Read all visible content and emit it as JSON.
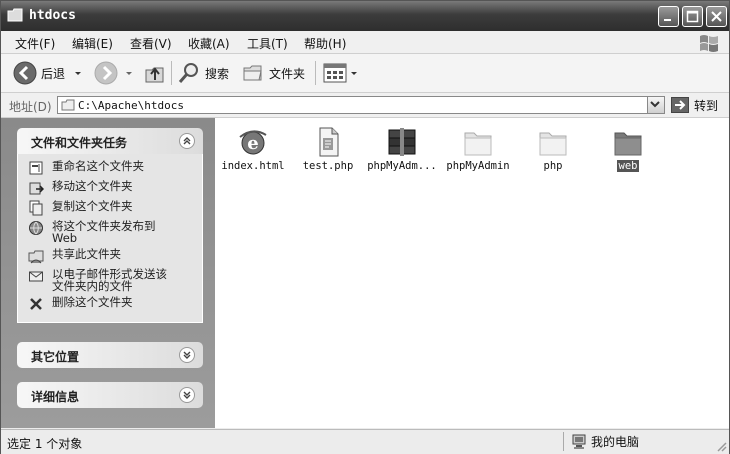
{
  "window": {
    "title": "htdocs"
  },
  "menu": [
    "文件(F)",
    "编辑(E)",
    "查看(V)",
    "收藏(A)",
    "工具(T)",
    "帮助(H)"
  ],
  "toolbar": {
    "back_label": "后退",
    "search_label": "搜索",
    "folders_label": "文件夹"
  },
  "address": {
    "label": "地址(D)",
    "path": "C:\\Apache\\htdocs",
    "go_label": "转到"
  },
  "tasks_panel": {
    "title": "文件和文件夹任务",
    "items": [
      {
        "label": "重命名这个文件夹",
        "icon": "rename-icon"
      },
      {
        "label": "移动这个文件夹",
        "icon": "move-icon"
      },
      {
        "label": "复制这个文件夹",
        "icon": "copy-icon"
      },
      {
        "label": "将这个文件夹发布到",
        "label2": "Web",
        "icon": "publish-web-icon"
      },
      {
        "label": "共享此文件夹",
        "icon": "share-icon"
      },
      {
        "label": "以电子邮件形式发送该",
        "label2": "文件夹内的文件",
        "icon": "email-icon"
      },
      {
        "label": "删除这个文件夹",
        "icon": "delete-icon"
      }
    ]
  },
  "other_places": {
    "title": "其它位置"
  },
  "details": {
    "title": "详细信息"
  },
  "files": [
    {
      "name": "index.html",
      "icon": "ie-html-icon"
    },
    {
      "name": "test.php",
      "icon": "php-file-icon"
    },
    {
      "name": "phpMyAdm...",
      "icon": "archive-icon"
    },
    {
      "name": "phpMyAdmin",
      "icon": "folder-icon"
    },
    {
      "name": "php",
      "icon": "folder-icon"
    },
    {
      "name": "web",
      "icon": "folder-icon",
      "selected": true
    }
  ],
  "status": {
    "left": "选定 1 个对象",
    "right": "我的电脑"
  }
}
